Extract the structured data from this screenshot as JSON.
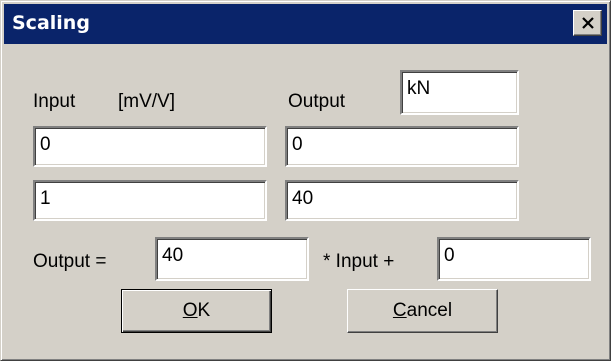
{
  "window": {
    "title": "Scaling",
    "close_icon": "close-icon",
    "titlebar_color": "#0a246a"
  },
  "labels": {
    "input": "Input",
    "input_unit": "[mV/V]",
    "output": "Output",
    "output_eq": "Output =",
    "input_plus": "* Input +"
  },
  "fields": {
    "output_unit": "kN",
    "input_1": "0",
    "output_1": "0",
    "input_2": "1",
    "output_2": "40",
    "factor": "40",
    "offset": "0"
  },
  "buttons": {
    "ok_mnemonic": "O",
    "ok_rest": "K",
    "cancel_mnemonic": "C",
    "cancel_rest": "ancel"
  }
}
